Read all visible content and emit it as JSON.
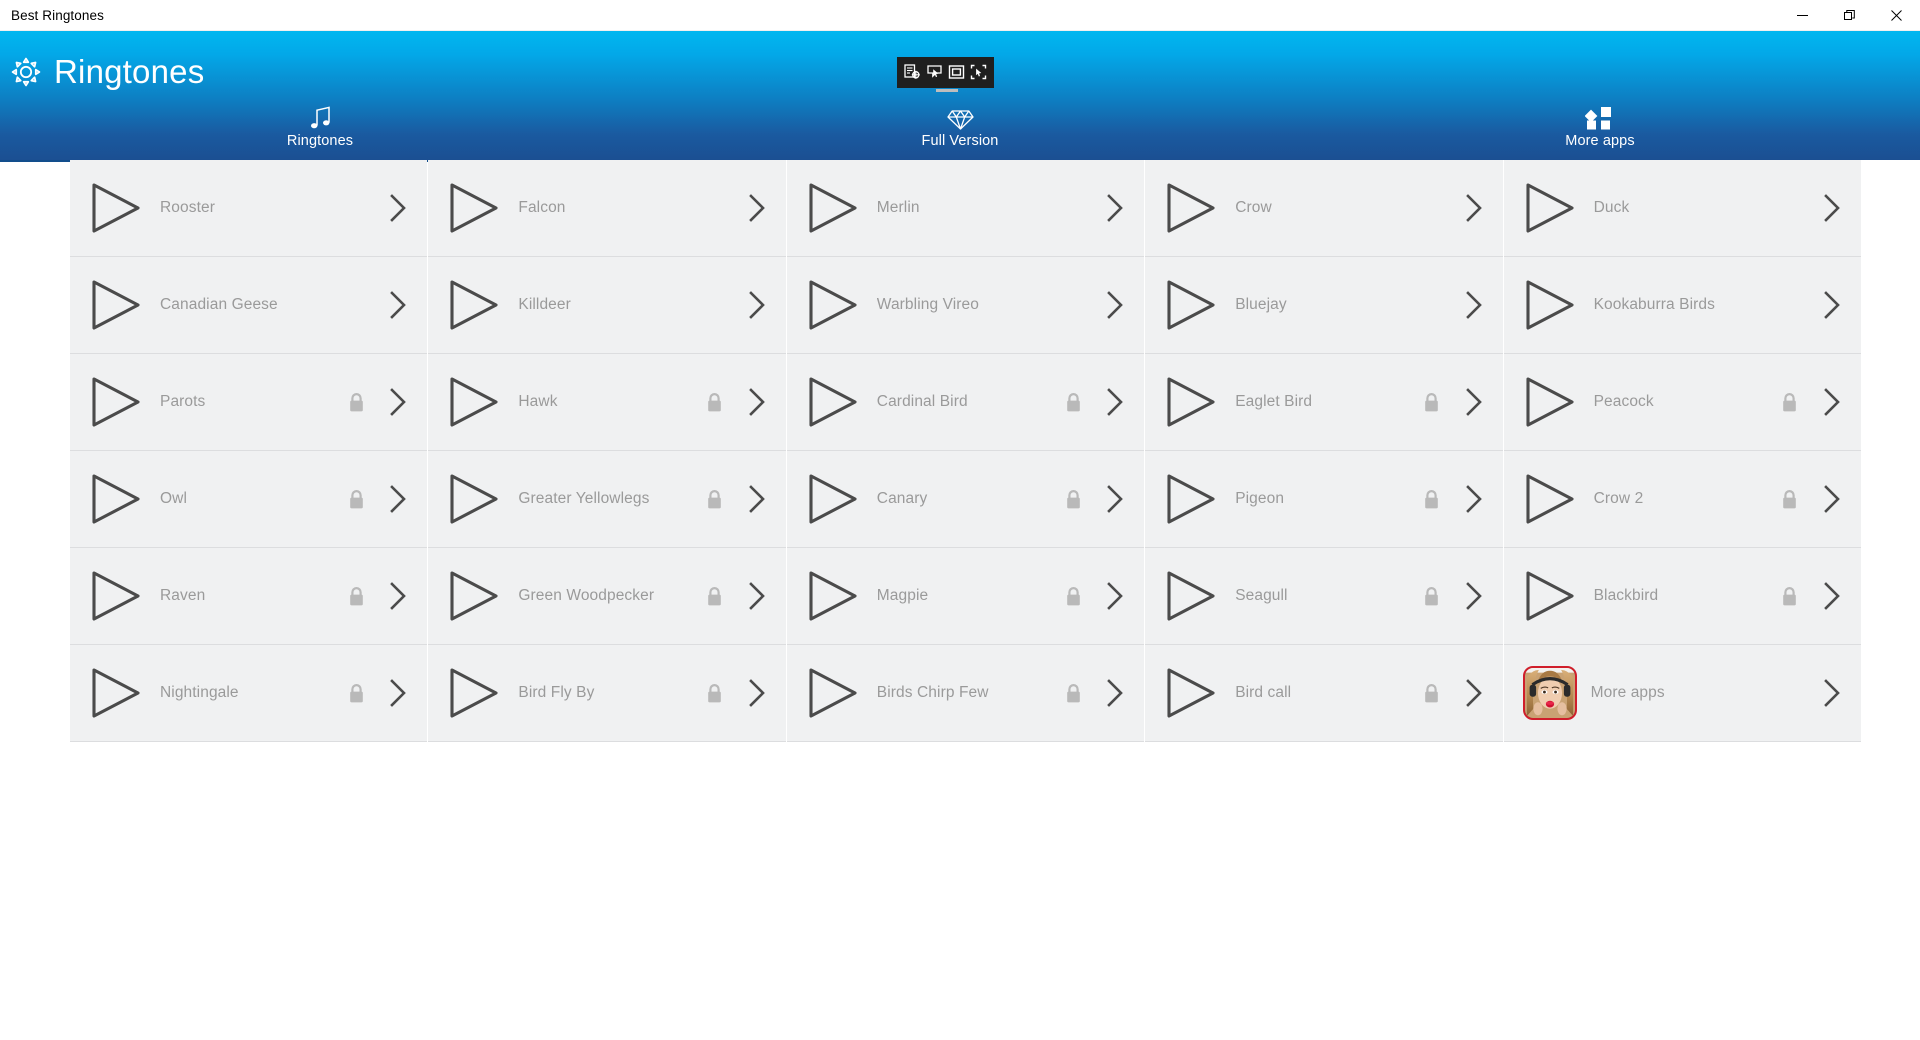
{
  "window": {
    "title": "Best Ringtones",
    "controls": [
      {
        "name": "minimize",
        "glyph": "minimize-icon"
      },
      {
        "name": "restore",
        "glyph": "restore-icon"
      },
      {
        "name": "close",
        "glyph": "close-icon"
      }
    ]
  },
  "capture_toolbar": {
    "buttons": [
      {
        "name": "snip-region-icon",
        "label": "Snip region"
      },
      {
        "name": "cursor-capture-icon",
        "label": "Capture cursor"
      },
      {
        "name": "window-capture-icon",
        "label": "Capture window"
      },
      {
        "name": "fullscreen-capture-icon",
        "label": "Capture screen"
      }
    ]
  },
  "header": {
    "brand_icon": "gear-icon",
    "brand_title": "Ringtones",
    "accent_top": "#00b7f0",
    "accent_bottom": "#1b4f92",
    "active_underline": "#124e8c"
  },
  "tabs": [
    {
      "id": "ringtones",
      "label": "Ringtones",
      "icon": "music-note-icon",
      "active": true
    },
    {
      "id": "full-version",
      "label": "Full Version",
      "icon": "diamond-icon",
      "active": false
    },
    {
      "id": "more-apps",
      "label": "More apps",
      "icon": "apps-grid-icon",
      "active": false
    }
  ],
  "list": {
    "row_bg": "#f0f1f2",
    "label_color": "#9a9a9a",
    "icon_color": "#4b4b4b",
    "lock_color": "#b9b9b9",
    "columns": [
      {
        "index": 0,
        "items": [
          {
            "label": "Rooster",
            "locked": false,
            "icon": "play-icon",
            "action": "chevron-right-icon"
          },
          {
            "label": "Canadian Geese",
            "locked": false,
            "icon": "play-icon",
            "action": "chevron-right-icon"
          },
          {
            "label": "Parots",
            "locked": true,
            "icon": "play-icon",
            "action": "chevron-right-icon"
          },
          {
            "label": "Owl",
            "locked": true,
            "icon": "play-icon",
            "action": "chevron-right-icon"
          },
          {
            "label": "Raven",
            "locked": true,
            "icon": "play-icon",
            "action": "chevron-right-icon"
          },
          {
            "label": "Nightingale",
            "locked": true,
            "icon": "play-icon",
            "action": "chevron-right-icon"
          }
        ]
      },
      {
        "index": 1,
        "items": [
          {
            "label": "Falcon",
            "locked": false,
            "icon": "play-icon",
            "action": "chevron-right-icon"
          },
          {
            "label": "Killdeer",
            "locked": false,
            "icon": "play-icon",
            "action": "chevron-right-icon"
          },
          {
            "label": "Hawk",
            "locked": true,
            "icon": "play-icon",
            "action": "chevron-right-icon"
          },
          {
            "label": "Greater Yellowlegs",
            "locked": true,
            "icon": "play-icon",
            "action": "chevron-right-icon"
          },
          {
            "label": "Green Woodpecker",
            "locked": true,
            "icon": "play-icon",
            "action": "chevron-right-icon"
          },
          {
            "label": "Bird Fly By",
            "locked": true,
            "icon": "play-icon",
            "action": "chevron-right-icon"
          }
        ]
      },
      {
        "index": 2,
        "items": [
          {
            "label": "Merlin",
            "locked": false,
            "icon": "play-icon",
            "action": "chevron-right-icon"
          },
          {
            "label": "Warbling Vireo",
            "locked": false,
            "icon": "play-icon",
            "action": "chevron-right-icon"
          },
          {
            "label": "Cardinal Bird",
            "locked": true,
            "icon": "play-icon",
            "action": "chevron-right-icon"
          },
          {
            "label": "Canary",
            "locked": true,
            "icon": "play-icon",
            "action": "chevron-right-icon"
          },
          {
            "label": "Magpie",
            "locked": true,
            "icon": "play-icon",
            "action": "chevron-right-icon"
          },
          {
            "label": "Birds Chirp Few",
            "locked": true,
            "icon": "play-icon",
            "action": "chevron-right-icon"
          }
        ]
      },
      {
        "index": 3,
        "items": [
          {
            "label": "Crow",
            "locked": false,
            "icon": "play-icon",
            "action": "chevron-right-icon"
          },
          {
            "label": "Bluejay",
            "locked": false,
            "icon": "play-icon",
            "action": "chevron-right-icon"
          },
          {
            "label": "Eaglet Bird",
            "locked": true,
            "icon": "play-icon",
            "action": "chevron-right-icon"
          },
          {
            "label": "Pigeon",
            "locked": true,
            "icon": "play-icon",
            "action": "chevron-right-icon"
          },
          {
            "label": "Seagull",
            "locked": true,
            "icon": "play-icon",
            "action": "chevron-right-icon"
          },
          {
            "label": "Bird call",
            "locked": true,
            "icon": "play-icon",
            "action": "chevron-right-icon"
          }
        ]
      },
      {
        "index": 4,
        "items": [
          {
            "label": "Duck",
            "locked": false,
            "icon": "play-icon",
            "action": "chevron-right-icon"
          },
          {
            "label": "Kookaburra Birds",
            "locked": false,
            "icon": "play-icon",
            "action": "chevron-right-icon"
          },
          {
            "label": "Peacock",
            "locked": true,
            "icon": "play-icon",
            "action": "chevron-right-icon"
          },
          {
            "label": "Crow 2",
            "locked": true,
            "icon": "play-icon",
            "action": "chevron-right-icon"
          },
          {
            "label": "Blackbird",
            "locked": true,
            "icon": "play-icon",
            "action": "chevron-right-icon"
          },
          {
            "label": "More apps",
            "locked": false,
            "icon": "app-thumbnail",
            "action": "chevron-right-icon"
          }
        ]
      }
    ]
  }
}
